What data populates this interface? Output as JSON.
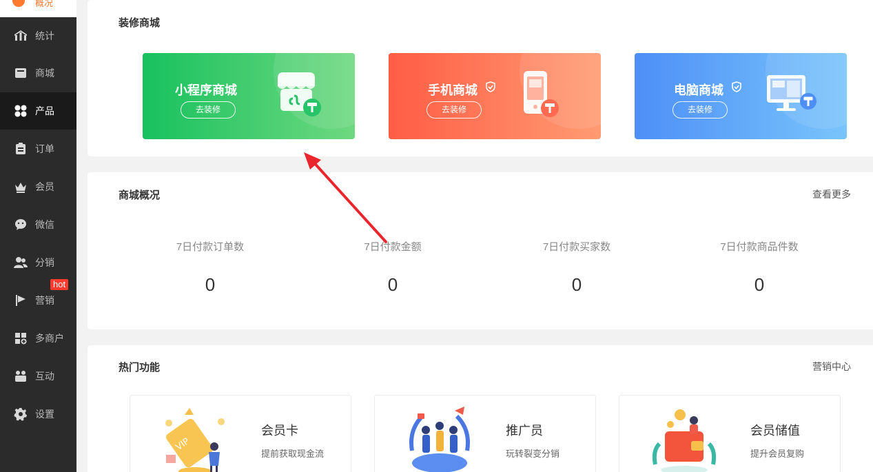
{
  "sidebar": {
    "brand": "概况",
    "items": [
      {
        "label": "统计",
        "icon": "chart-icon"
      },
      {
        "label": "商城",
        "icon": "store-icon"
      },
      {
        "label": "产品",
        "icon": "grid-icon"
      },
      {
        "label": "订单",
        "icon": "order-icon"
      },
      {
        "label": "会员",
        "icon": "crown-icon"
      },
      {
        "label": "微信",
        "icon": "wechat-icon"
      },
      {
        "label": "分销",
        "icon": "users-icon"
      },
      {
        "label": "营销",
        "icon": "flag-icon"
      },
      {
        "label": "多商户",
        "icon": "merchant-icon"
      },
      {
        "label": "互动",
        "icon": "interact-icon"
      },
      {
        "label": "设置",
        "icon": "gear-icon"
      }
    ],
    "hot_badge": "hot",
    "active": "产品"
  },
  "decorate": {
    "title": "装修商城",
    "cards": [
      {
        "title": "小程序商城",
        "button": "去装修",
        "color_from": "#18c15e",
        "color_to": "#6ed880"
      },
      {
        "title": "手机商城",
        "button": "去装修",
        "color_from": "#ff5d45",
        "color_to": "#ff9b72"
      },
      {
        "title": "电脑商城",
        "button": "去装修",
        "color_from": "#4d8ff7",
        "color_to": "#79c4fb"
      }
    ]
  },
  "overview": {
    "title": "商城概况",
    "more": "查看更多",
    "stats": [
      {
        "label": "7日付款订单数",
        "value": "0"
      },
      {
        "label": "7日付款金额",
        "value": "0"
      },
      {
        "label": "7日付款买家数",
        "value": "0"
      },
      {
        "label": "7日付款商品件数",
        "value": "0"
      }
    ]
  },
  "hot_features": {
    "title": "热门功能",
    "more": "营销中心",
    "items": [
      {
        "name": "会员卡",
        "desc": "提前获取现金流"
      },
      {
        "name": "推广员",
        "desc": "玩转裂变分销"
      },
      {
        "name": "会员储值",
        "desc": "提升会员复购"
      }
    ]
  },
  "colors": {
    "sidebar_bg": "#2b2b2b",
    "accent_orange": "#ff7a2f",
    "hot_red": "#ff3b30",
    "arrow_red": "#e8262b"
  }
}
